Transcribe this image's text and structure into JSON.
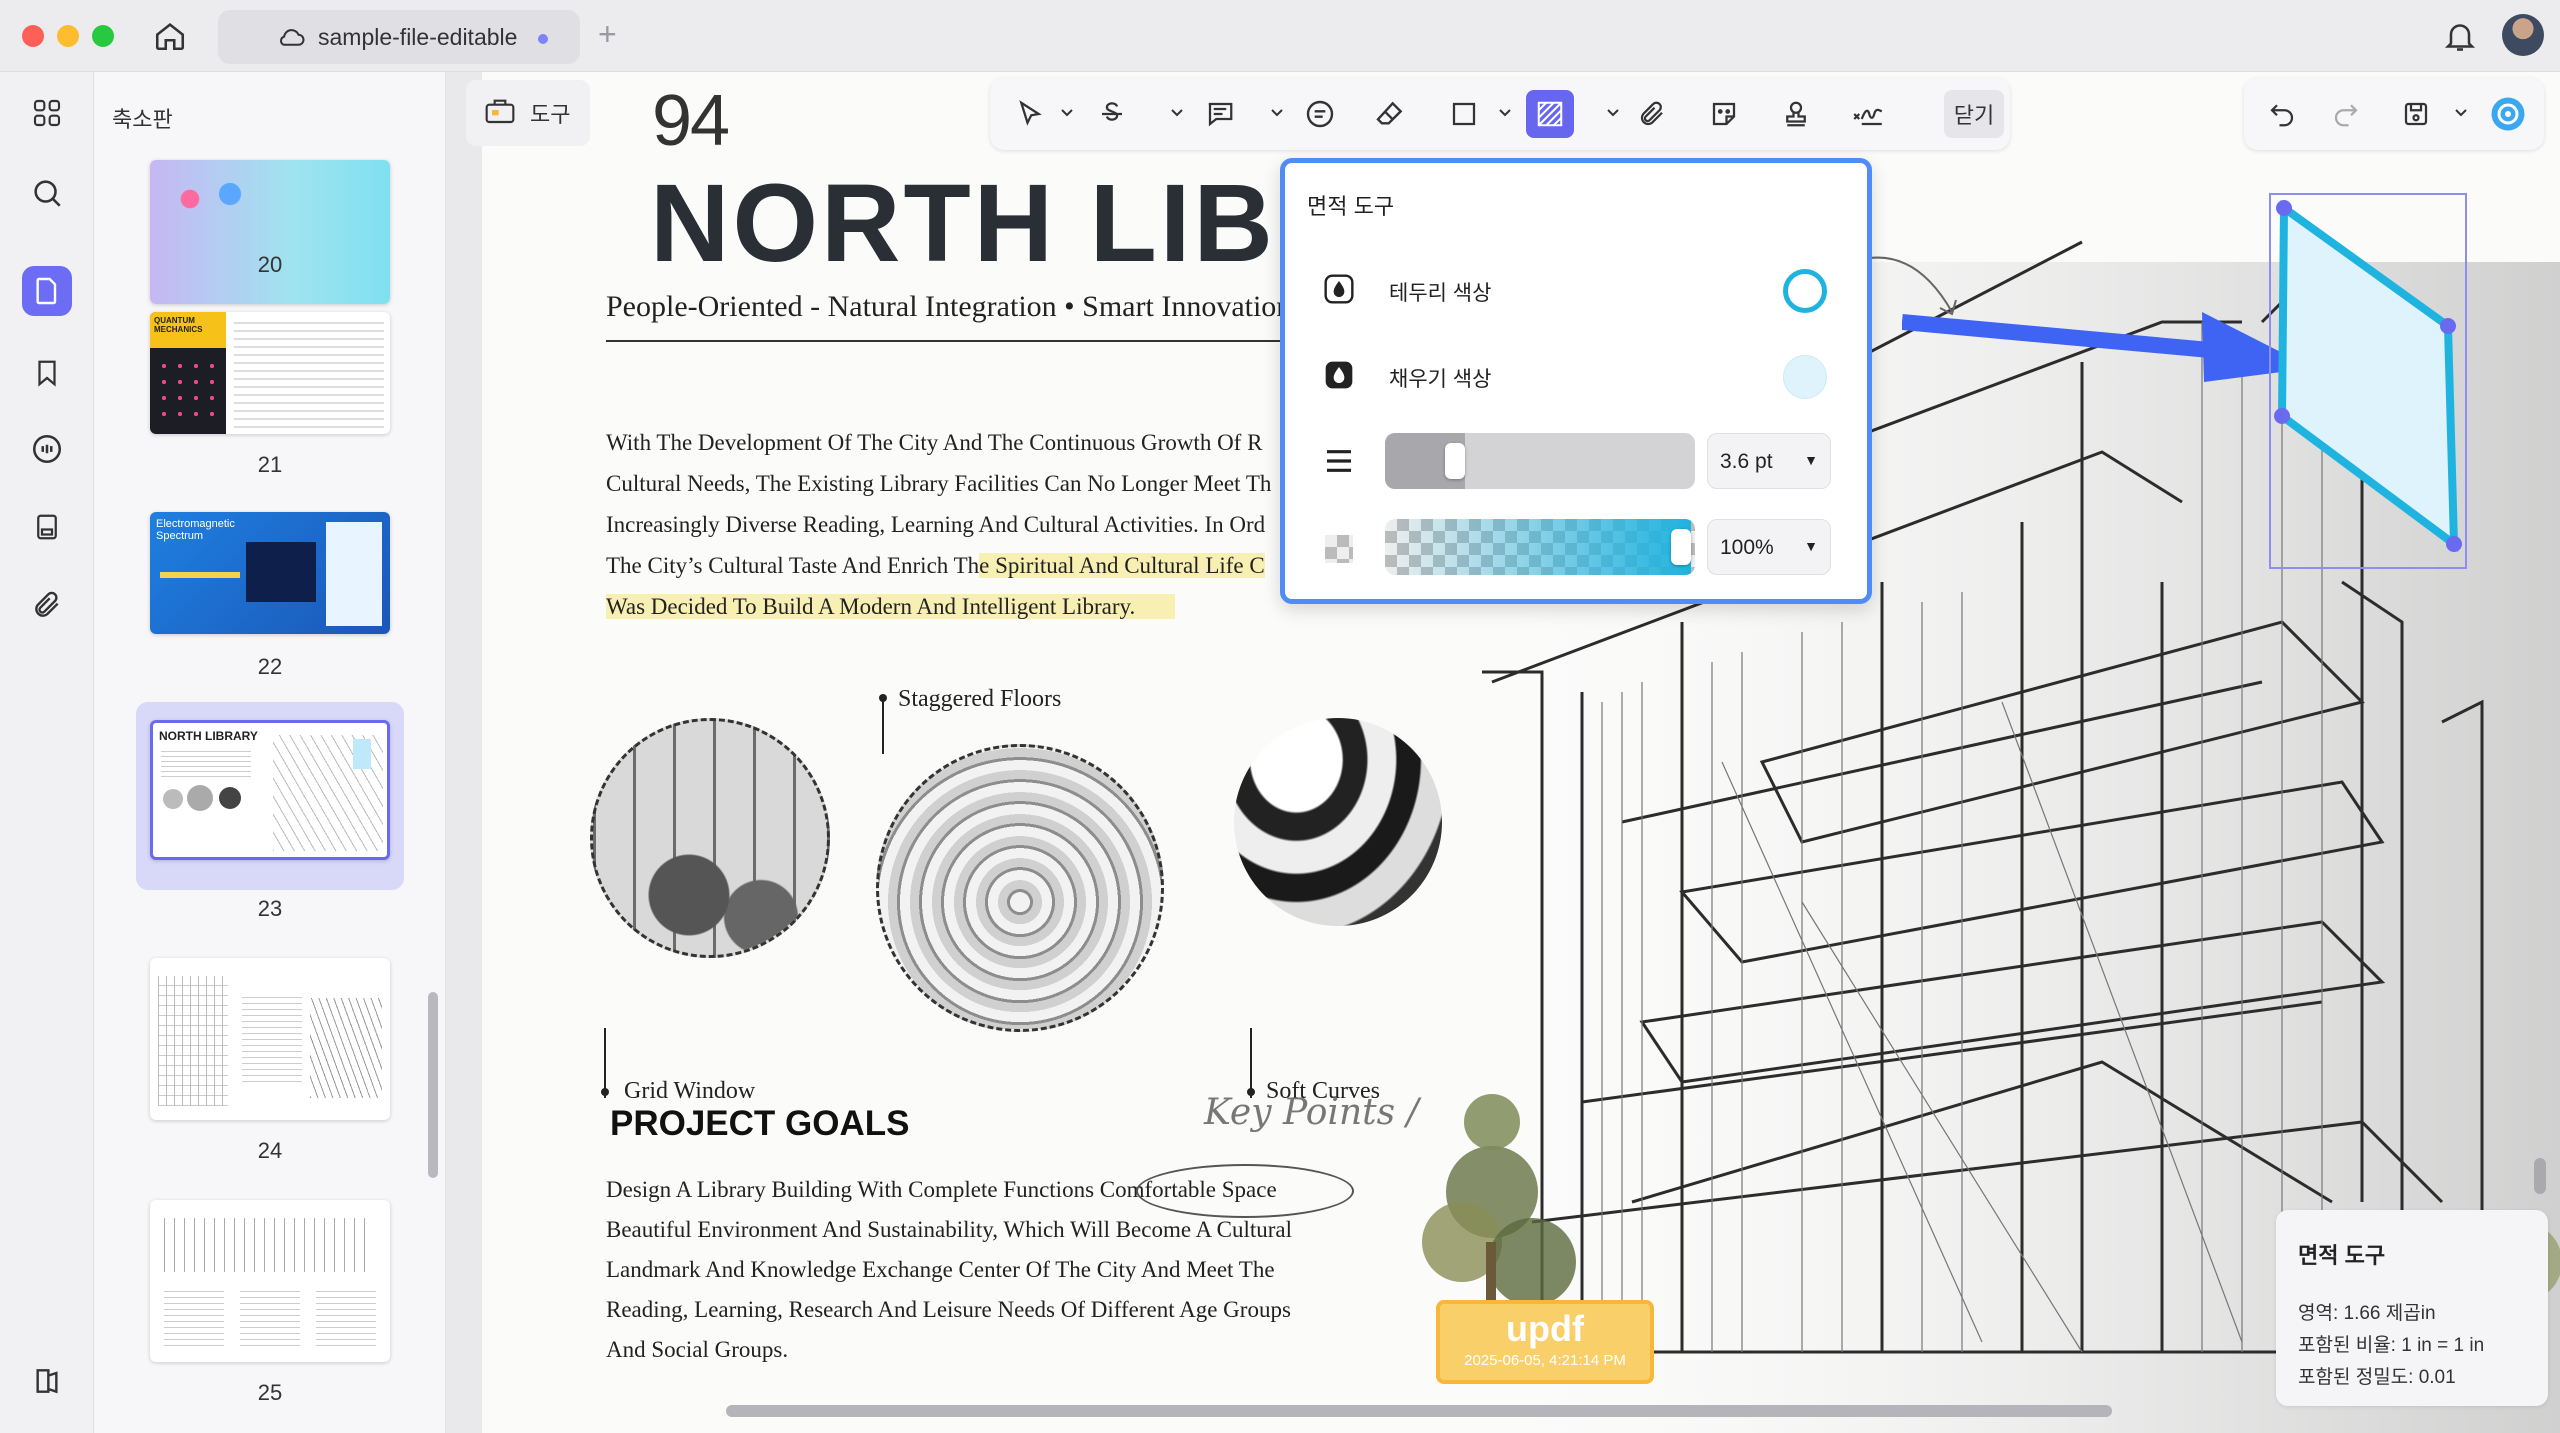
{
  "window": {
    "tab_title": "sample-file-editable",
    "new_tab": "+"
  },
  "rail": {
    "items": [
      "grid-icon",
      "search-icon",
      "document-icon",
      "bookmark-icon",
      "comment-icon",
      "form-icon",
      "attachment-icon"
    ],
    "bottom": "sidebar-toggle-icon"
  },
  "thumbnails": {
    "title": "축소판",
    "pages": [
      {
        "number": "20"
      },
      {
        "number": "21",
        "heading": "QUANTUM MECHANICS"
      },
      {
        "number": "22",
        "heading": "Electromagnetic Spectrum"
      },
      {
        "number": "23",
        "heading": "NORTH LIBRARY",
        "selected": true
      },
      {
        "number": "24"
      },
      {
        "number": "25"
      }
    ]
  },
  "toolbar": {
    "tool_label": "도구",
    "close_label": "닫기",
    "active_tool": "area-measure"
  },
  "page": {
    "page_number": "94",
    "title": "NORTH LIBRARY",
    "subtitle": "People-Oriented - Natural Integration • Smart Innovation",
    "intro_lines": [
      "With The Development Of The City And The Continuous Growth Of R",
      "Cultural Needs, The Existing Library Facilities Can No Longer Meet Th",
      "Increasingly Diverse Reading, Learning And Cultural Activities. In Ord",
      "The City’s Cultural Taste And Enrich Th",
      "e Spiritual And Cultural Life C",
      "Was Decided To Build A Modern And Intelligent Library."
    ],
    "captions": {
      "staggered": "Staggered Floors",
      "grid": "Grid Window",
      "soft": "Soft Curves"
    },
    "goals_title": "PROJECT GOALS",
    "key_points": "Key Points /",
    "goals_lines": [
      "Design A Library Building With Complete Functions Comfortable Space",
      "Beautiful Environment And Sustainability, Which Will Become A Cultural",
      "Landmark And Knowledge Exchange Center Of The City And Meet The",
      "Reading, Learning, Research And Leisure Needs Of Different Age Groups",
      "And Social Groups."
    ],
    "stamp": {
      "title": "updf",
      "date": "2025-06-05, 4:21:14 PM"
    }
  },
  "popup": {
    "title": "면적 도구",
    "border_color_label": "테두리 색상",
    "fill_color_label": "채우기 색상",
    "border_color": "#1fb3e0",
    "fill_color": "#dff3fd",
    "stroke_width": "3.6 pt",
    "stroke_level": 0.2,
    "opacity": "100%",
    "opacity_level": 1.0
  },
  "info": {
    "title": "면적 도구",
    "area": "영역: 1.66 제곱in",
    "ratio": "포함된 비율: 1 in = 1 in",
    "precision": "포함된 정밀도: 0.01"
  }
}
